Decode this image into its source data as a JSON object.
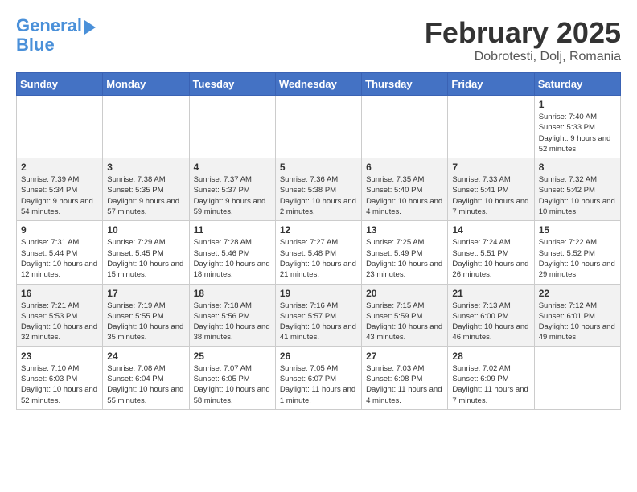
{
  "logo": {
    "line1": "General",
    "line2": "Blue"
  },
  "title": "February 2025",
  "location": "Dobrotesti, Dolj, Romania",
  "weekdays": [
    "Sunday",
    "Monday",
    "Tuesday",
    "Wednesday",
    "Thursday",
    "Friday",
    "Saturday"
  ],
  "weeks": [
    [
      {
        "day": "",
        "info": ""
      },
      {
        "day": "",
        "info": ""
      },
      {
        "day": "",
        "info": ""
      },
      {
        "day": "",
        "info": ""
      },
      {
        "day": "",
        "info": ""
      },
      {
        "day": "",
        "info": ""
      },
      {
        "day": "1",
        "info": "Sunrise: 7:40 AM\nSunset: 5:33 PM\nDaylight: 9 hours and 52 minutes."
      }
    ],
    [
      {
        "day": "2",
        "info": "Sunrise: 7:39 AM\nSunset: 5:34 PM\nDaylight: 9 hours and 54 minutes."
      },
      {
        "day": "3",
        "info": "Sunrise: 7:38 AM\nSunset: 5:35 PM\nDaylight: 9 hours and 57 minutes."
      },
      {
        "day": "4",
        "info": "Sunrise: 7:37 AM\nSunset: 5:37 PM\nDaylight: 9 hours and 59 minutes."
      },
      {
        "day": "5",
        "info": "Sunrise: 7:36 AM\nSunset: 5:38 PM\nDaylight: 10 hours and 2 minutes."
      },
      {
        "day": "6",
        "info": "Sunrise: 7:35 AM\nSunset: 5:40 PM\nDaylight: 10 hours and 4 minutes."
      },
      {
        "day": "7",
        "info": "Sunrise: 7:33 AM\nSunset: 5:41 PM\nDaylight: 10 hours and 7 minutes."
      },
      {
        "day": "8",
        "info": "Sunrise: 7:32 AM\nSunset: 5:42 PM\nDaylight: 10 hours and 10 minutes."
      }
    ],
    [
      {
        "day": "9",
        "info": "Sunrise: 7:31 AM\nSunset: 5:44 PM\nDaylight: 10 hours and 12 minutes."
      },
      {
        "day": "10",
        "info": "Sunrise: 7:29 AM\nSunset: 5:45 PM\nDaylight: 10 hours and 15 minutes."
      },
      {
        "day": "11",
        "info": "Sunrise: 7:28 AM\nSunset: 5:46 PM\nDaylight: 10 hours and 18 minutes."
      },
      {
        "day": "12",
        "info": "Sunrise: 7:27 AM\nSunset: 5:48 PM\nDaylight: 10 hours and 21 minutes."
      },
      {
        "day": "13",
        "info": "Sunrise: 7:25 AM\nSunset: 5:49 PM\nDaylight: 10 hours and 23 minutes."
      },
      {
        "day": "14",
        "info": "Sunrise: 7:24 AM\nSunset: 5:51 PM\nDaylight: 10 hours and 26 minutes."
      },
      {
        "day": "15",
        "info": "Sunrise: 7:22 AM\nSunset: 5:52 PM\nDaylight: 10 hours and 29 minutes."
      }
    ],
    [
      {
        "day": "16",
        "info": "Sunrise: 7:21 AM\nSunset: 5:53 PM\nDaylight: 10 hours and 32 minutes."
      },
      {
        "day": "17",
        "info": "Sunrise: 7:19 AM\nSunset: 5:55 PM\nDaylight: 10 hours and 35 minutes."
      },
      {
        "day": "18",
        "info": "Sunrise: 7:18 AM\nSunset: 5:56 PM\nDaylight: 10 hours and 38 minutes."
      },
      {
        "day": "19",
        "info": "Sunrise: 7:16 AM\nSunset: 5:57 PM\nDaylight: 10 hours and 41 minutes."
      },
      {
        "day": "20",
        "info": "Sunrise: 7:15 AM\nSunset: 5:59 PM\nDaylight: 10 hours and 43 minutes."
      },
      {
        "day": "21",
        "info": "Sunrise: 7:13 AM\nSunset: 6:00 PM\nDaylight: 10 hours and 46 minutes."
      },
      {
        "day": "22",
        "info": "Sunrise: 7:12 AM\nSunset: 6:01 PM\nDaylight: 10 hours and 49 minutes."
      }
    ],
    [
      {
        "day": "23",
        "info": "Sunrise: 7:10 AM\nSunset: 6:03 PM\nDaylight: 10 hours and 52 minutes."
      },
      {
        "day": "24",
        "info": "Sunrise: 7:08 AM\nSunset: 6:04 PM\nDaylight: 10 hours and 55 minutes."
      },
      {
        "day": "25",
        "info": "Sunrise: 7:07 AM\nSunset: 6:05 PM\nDaylight: 10 hours and 58 minutes."
      },
      {
        "day": "26",
        "info": "Sunrise: 7:05 AM\nSunset: 6:07 PM\nDaylight: 11 hours and 1 minute."
      },
      {
        "day": "27",
        "info": "Sunrise: 7:03 AM\nSunset: 6:08 PM\nDaylight: 11 hours and 4 minutes."
      },
      {
        "day": "28",
        "info": "Sunrise: 7:02 AM\nSunset: 6:09 PM\nDaylight: 11 hours and 7 minutes."
      },
      {
        "day": "",
        "info": ""
      }
    ]
  ]
}
